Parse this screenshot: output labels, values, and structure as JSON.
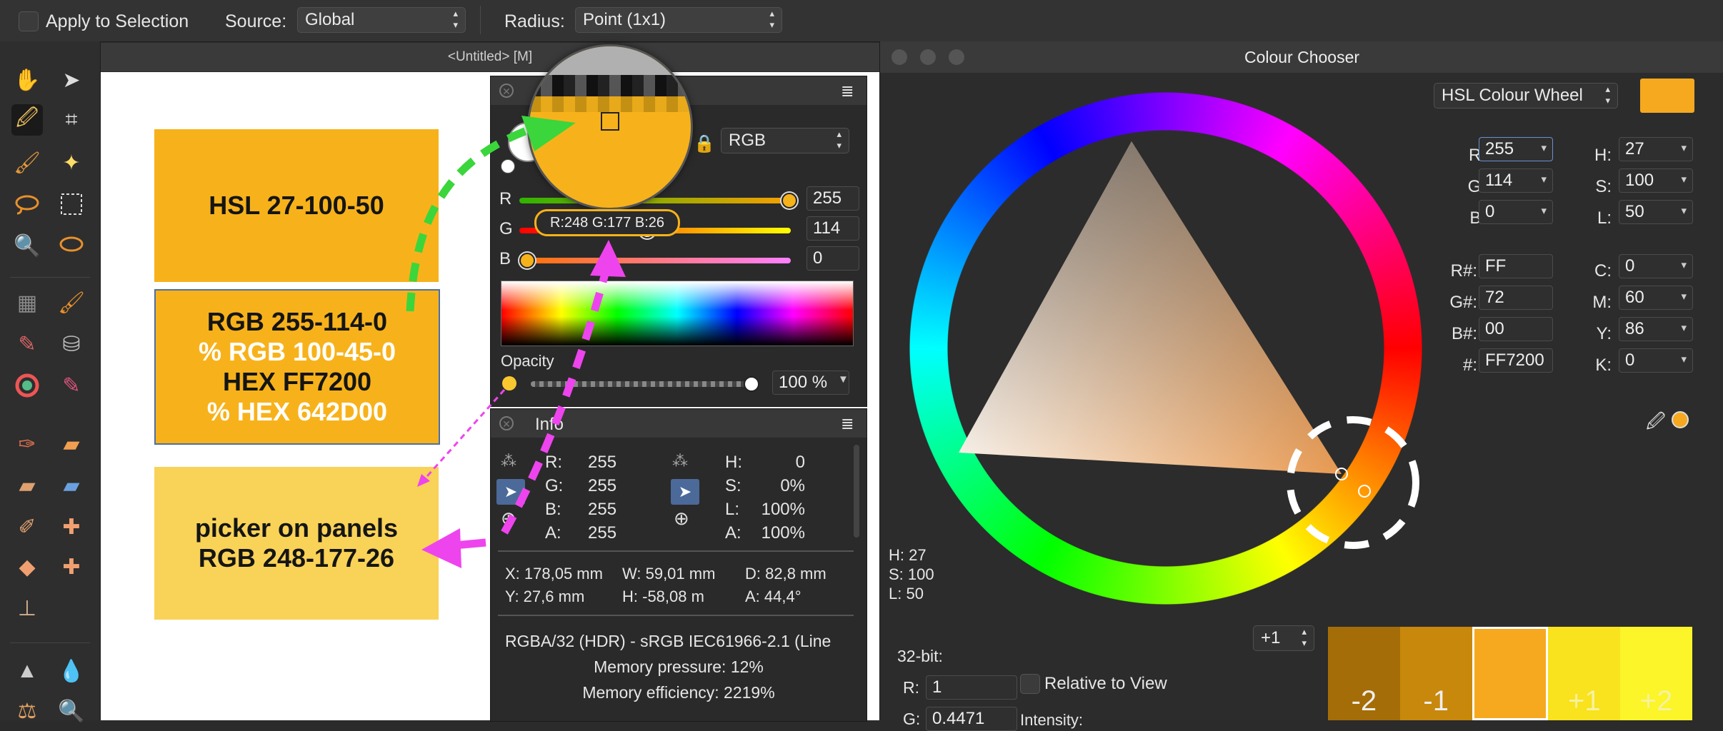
{
  "toolbar": {
    "apply_label": "Apply to Selection",
    "source_label": "Source:",
    "source_value": "Global",
    "radius_label": "Radius:",
    "radius_value": "Point (1x1)"
  },
  "document": {
    "title": "<Untitled> [M]"
  },
  "swatches": {
    "hsl": "HSL 27-100-50",
    "rgb_lines": [
      "RGB 255-114-0",
      "% RGB 100-45-0",
      "HEX FF7200",
      "% HEX 642D00"
    ],
    "picker_lines": [
      "picker on panels",
      "RGB 248-177-26"
    ]
  },
  "colour_panel": {
    "mode": "RGB",
    "r_label": "R",
    "g_label": "G",
    "b_label": "B",
    "r_value": "255",
    "g_value": "114",
    "b_value": "0",
    "r_fraction": 1.0,
    "g_fraction": 0.447,
    "b_fraction": 0.0,
    "tooltip": "R:248 G:177 B:26",
    "opacity_label": "Opacity",
    "opacity_value": "100 %",
    "opacity_fraction": 1.0
  },
  "info_panel": {
    "title": "Info",
    "rgba": [
      {
        "label": "R:",
        "value": "255"
      },
      {
        "label": "G:",
        "value": "255"
      },
      {
        "label": "B:",
        "value": "255"
      },
      {
        "label": "A:",
        "value": "255"
      }
    ],
    "hsla": [
      {
        "label": "H:",
        "value": "0"
      },
      {
        "label": "S:",
        "value": "0%"
      },
      {
        "label": "L:",
        "value": "100%"
      },
      {
        "label": "A:",
        "value": "100%"
      }
    ],
    "x": "X: 178,05 mm",
    "y": "Y: 27,6 mm",
    "w": "W: 59,01 mm",
    "h": "H: -58,08 m",
    "d": "D: 82,8 mm",
    "a": "A: 44,4°",
    "format": "RGBA/32 (HDR) - sRGB IEC61966-2.1 (Line",
    "memory_pressure": "Memory pressure: 12%",
    "memory_efficiency": "Memory efficiency: 2219%"
  },
  "colour_chooser": {
    "title": "Colour Chooser",
    "model": "HSL Colour Wheel",
    "fields_left": [
      {
        "label": "R:",
        "value": "255"
      },
      {
        "label": "G:",
        "value": "114"
      },
      {
        "label": "B:",
        "value": "0"
      }
    ],
    "fields_right": [
      {
        "label": "H:",
        "value": "27"
      },
      {
        "label": "S:",
        "value": "100"
      },
      {
        "label": "L:",
        "value": "50"
      }
    ],
    "hex_fields": [
      {
        "label": "R#:",
        "value": "FF"
      },
      {
        "label": "G#:",
        "value": "72"
      },
      {
        "label": "B#:",
        "value": "00"
      },
      {
        "label": "#:",
        "value": "FF7200"
      }
    ],
    "cmyk_fields": [
      {
        "label": "C:",
        "value": "0"
      },
      {
        "label": "M:",
        "value": "60"
      },
      {
        "label": "Y:",
        "value": "86"
      },
      {
        "label": "K:",
        "value": "0"
      }
    ],
    "hsl_readout": [
      "H: 27",
      "S: 100",
      "L: 50"
    ],
    "bit_label": "32-bit:",
    "bit_r": {
      "label": "R:",
      "value": "1"
    },
    "bit_g": {
      "label": "G:",
      "value": "0.4471"
    },
    "relative_label": "Relative to View",
    "intensity_label": "Intensity:",
    "step_value": "+1",
    "steps": [
      "-2",
      "-1",
      "",
      "+1",
      "+2"
    ]
  },
  "colors": {
    "accent": "#f7b21b",
    "current": "#f6a91f"
  }
}
